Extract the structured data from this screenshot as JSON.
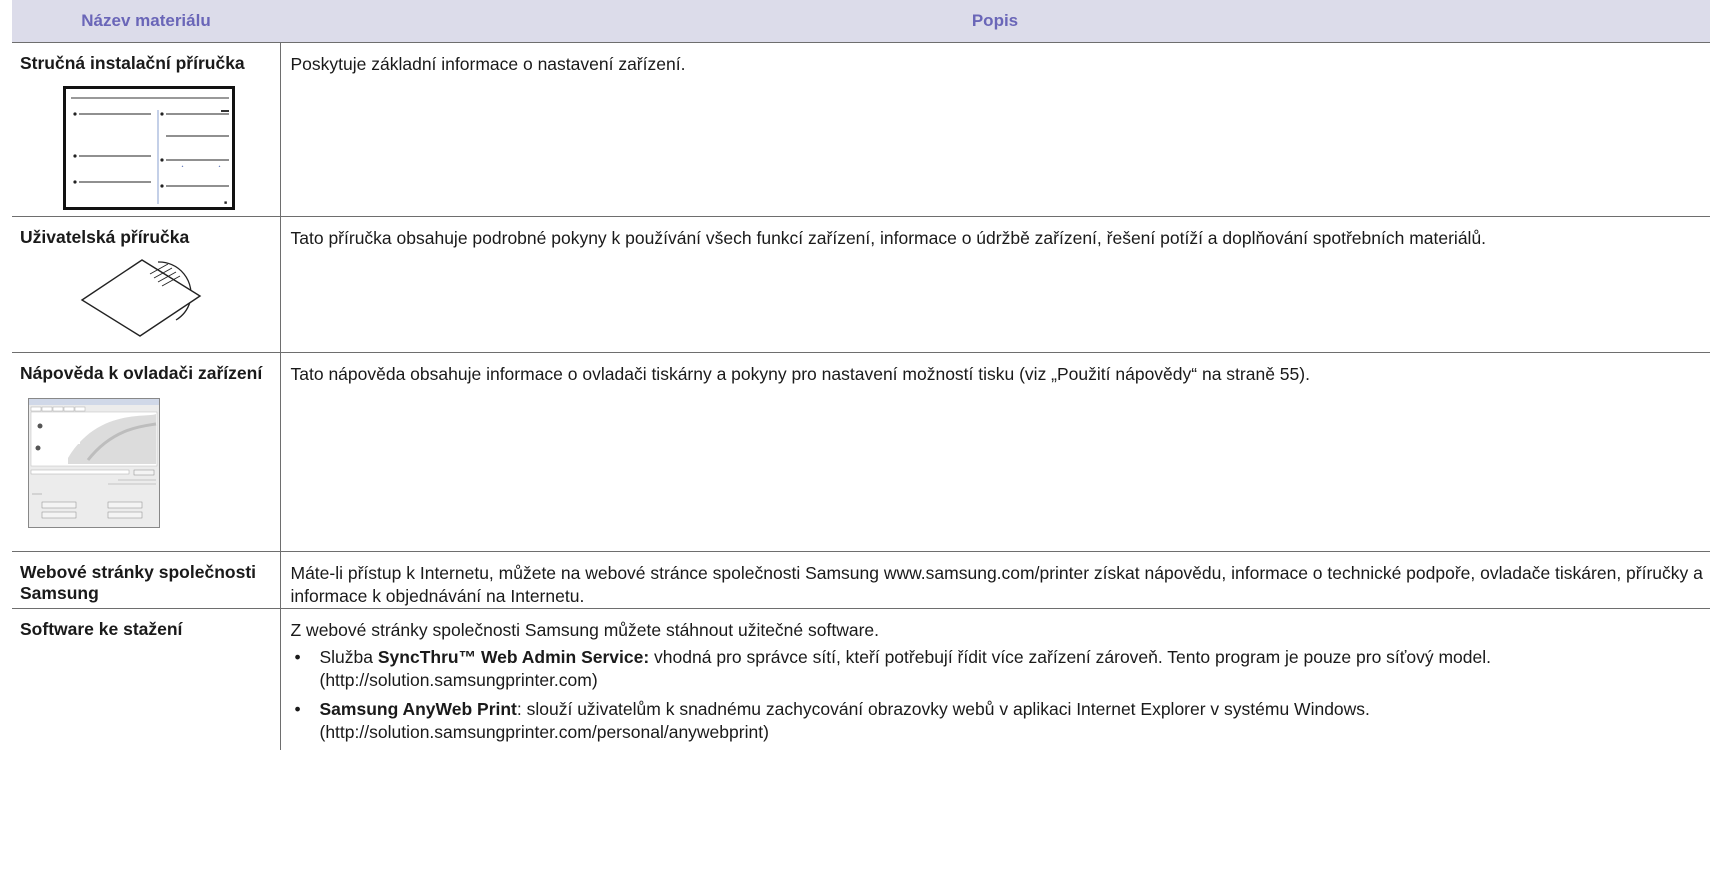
{
  "table": {
    "headers": [
      "Název materiálu",
      "Popis"
    ],
    "rows": [
      {
        "name": "Stručná instalační příručka",
        "description": "Poskytuje základní informace o nastavení zařízení.",
        "figure": "quick-install-guide-thumbnail"
      },
      {
        "name": "Uživatelská příručka",
        "description": "Tato příručka obsahuje podrobné pokyny k používání všech funkcí zařízení, informace o údržbě zařízení, řešení potíží a doplňování spotřebních materiálů.",
        "figure": "cd-disc-sleeve-illustration"
      },
      {
        "name": "Nápověda k ovladači zařízení",
        "description": "Tato nápověda obsahuje informace o ovladači tiskárny a pokyny pro nastavení možností tisku (viz „Použití nápovědy“ na straně 55).",
        "figure": "printer-driver-dialog-screenshot"
      },
      {
        "name": "Webové stránky společnosti Samsung",
        "description": "Máte-li přístup k Internetu, můžete na webové stránce společnosti Samsung www.samsung.com/printer získat nápovědu, informace o technické podpoře, ovladače tiskáren, příručky a informace k objednávání na Internetu."
      },
      {
        "name": "Software ke stažení",
        "description": "Z webové stránky společnosti Samsung můžete stáhnout užitečné software.",
        "bullets": [
          {
            "pre": "Služba ",
            "bold": "SyncThru™ Web Admin Service:",
            "text": " vhodná pro správce sítí, kteří potřebují řídit více zařízení zároveň. Tento program je pouze pro síťový model. (http://solution.samsungprinter.com)"
          },
          {
            "pre": "",
            "bold": "Samsung AnyWeb Print",
            "text": ": slouží uživatelům k snadnému zachycování obrazovky webů v aplikaci Internet Explorer v systému Windows. (http://solution.samsungprinter.com/personal/anywebprint)"
          }
        ]
      }
    ]
  },
  "bullet_glyph": "•"
}
